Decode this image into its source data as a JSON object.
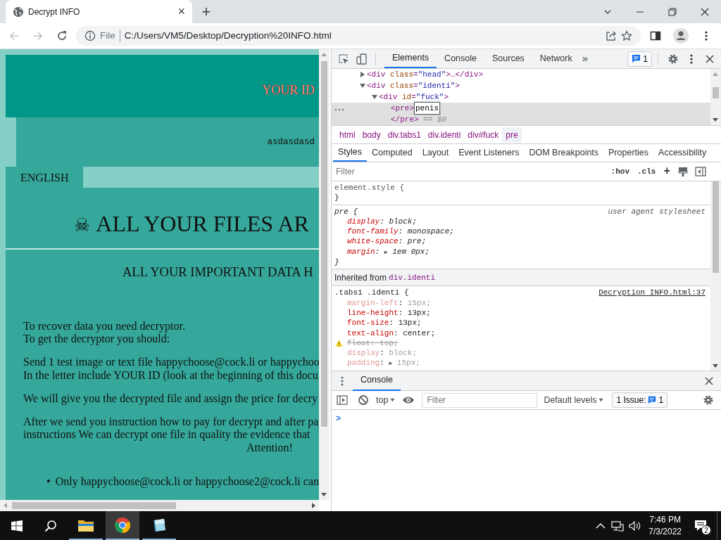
{
  "browser": {
    "tab": {
      "title": "Decrypt INFO",
      "close": "×"
    },
    "new_tab": "+",
    "back": {
      "disabled": true
    },
    "forward": {
      "disabled": true
    },
    "address": {
      "scheme": "File",
      "url": "C:/Users/VM5/Desktop/Decryption%20INFO.html"
    }
  },
  "page": {
    "your_id": "YOUR ID",
    "id_value": "asdasdasd",
    "language_tab": "ENGLISH",
    "skull": "☠",
    "headline": "ALL YOUR FILES AR",
    "subheadline": "ALL YOUR IMPORTANT DATA H",
    "paragraphs": [
      [
        "To recover data you need decryptor.",
        "To get the decryptor you should:"
      ],
      [
        "Send 1 test image or text file happychoose@cock.li or happychoo",
        "In the letter include YOUR ID (look at the beginning of this docu"
      ],
      [
        "We will give you the decrypted file and assign the price for decry"
      ],
      [
        "After we send you instruction how to pay for decrypt and after pa",
        "instructions We can decrypt one file in quality the evidence that"
      ]
    ],
    "attention": "Attention!",
    "bullets": [
      {
        "marker": "•",
        "text": "Only happychoose@cock.li or happychoose2@cock.li can"
      }
    ]
  },
  "devtools": {
    "tabs": [
      {
        "label": "Elements",
        "selected": true
      },
      {
        "label": "Console",
        "selected": false
      },
      {
        "label": "Sources",
        "selected": false
      },
      {
        "label": "Network",
        "selected": false
      }
    ],
    "more_tabs": "»",
    "issues_badge": "1",
    "dom": [
      {
        "tag": "<div class=\"head\">…</div>",
        "expanded": false,
        "selected": false
      },
      {
        "tag": "<div class=\"identi\">",
        "expanded": true,
        "selected": false,
        "children": [
          {
            "tag": "<div id=\"fuck\">",
            "expanded": true,
            "selected": false,
            "children": [
              {
                "tag": "<pre>",
                "editing": "penis",
                "close_tag": "</pre>",
                "suffix": "== $0",
                "selected": true
              }
            ]
          }
        ]
      }
    ],
    "breadcrumbs": [
      {
        "label": "html",
        "selected": false
      },
      {
        "label": "body",
        "selected": false
      },
      {
        "label": "div.tabs1",
        "selected": false
      },
      {
        "label": "div.identi",
        "selected": false
      },
      {
        "label": "div#fuck",
        "selected": false
      },
      {
        "label": "pre",
        "selected": true
      }
    ],
    "panel_tabs": [
      {
        "label": "Styles",
        "selected": true
      },
      {
        "label": "Computed",
        "selected": false
      },
      {
        "label": "Layout",
        "selected": false
      },
      {
        "label": "Event Listeners",
        "selected": false
      },
      {
        "label": "DOM Breakpoints",
        "selected": false
      },
      {
        "label": "Properties",
        "selected": false
      },
      {
        "label": "Accessibility",
        "selected": false
      }
    ],
    "styles_filter": {
      "placeholder": "Filter",
      "hov": ":hov",
      "cls": ".cls",
      "add": "+"
    },
    "rules": [
      {
        "kind": "inline",
        "selector": "element.style",
        "open": "{",
        "close": "}"
      },
      {
        "kind": "user-agent",
        "selector": "pre",
        "open": "{",
        "close": "}",
        "source": "user agent stylesheet",
        "props": [
          {
            "name": "display",
            "sep": ":",
            "value": "block;",
            "kind": "active"
          },
          {
            "name": "font-family",
            "sep": ":",
            "value": "monospace;",
            "kind": "active"
          },
          {
            "name": "white-space",
            "sep": ":",
            "value": "pre;",
            "kind": "active"
          },
          {
            "name": "margin",
            "sep": ":",
            "value": "1em 0px;",
            "kind": "active",
            "expander": "▶"
          }
        ]
      },
      {
        "kind": "inherited-header",
        "label": "Inherited from",
        "from": "div.identi"
      },
      {
        "kind": "author",
        "selector": ".tabs1 .identi",
        "open": "{",
        "source": "Decryption INFO.html:37",
        "props": [
          {
            "name": "margin-left",
            "sep": ":",
            "value": "15px;",
            "kind": "inactive"
          },
          {
            "name": "line-height",
            "sep": ":",
            "value": "13px;",
            "kind": "active"
          },
          {
            "name": "font-size",
            "sep": ":",
            "value": "13px;",
            "kind": "active"
          },
          {
            "name": "text-align",
            "sep": ":",
            "value": "center;",
            "kind": "active"
          },
          {
            "name": "float",
            "sep": ":",
            "value": "top;",
            "kind": "invalid"
          },
          {
            "name": "display",
            "sep": ":",
            "value": "block;",
            "kind": "inactive"
          },
          {
            "name": "padding",
            "sep": ":",
            "value": "15px;",
            "kind": "inactive",
            "expander": "▶"
          }
        ]
      }
    ],
    "console": {
      "drawer_tab": "Console",
      "context": "top",
      "filter_placeholder": "Filter",
      "levels": "Default levels",
      "issues_label": "1 Issue:",
      "issues_count": "1",
      "prompt": ">"
    }
  },
  "taskbar": {
    "apps": [
      {
        "kind": "folder",
        "selected": false
      },
      {
        "kind": "browser",
        "selected": true
      },
      {
        "kind": "notepad",
        "selected": false
      }
    ],
    "time": "7:46 PM",
    "date": "7/3/2022",
    "notifications": "2"
  }
}
